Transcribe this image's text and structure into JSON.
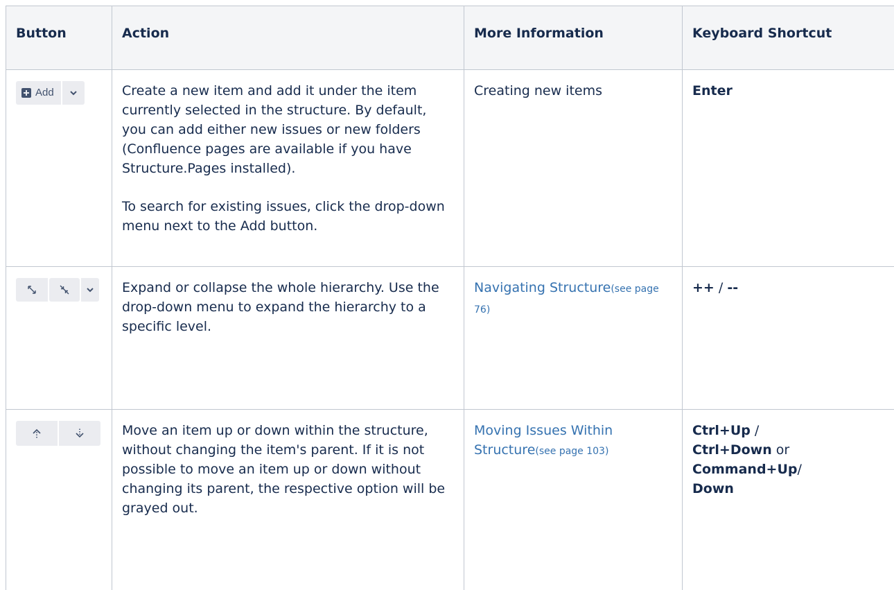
{
  "headers": {
    "button": "Button",
    "action": "Action",
    "more_info": "More Information",
    "shortcut": "Keyboard Shortcut"
  },
  "rows": [
    {
      "button": {
        "add_label": "Add",
        "icons": [
          "plus-square-icon",
          "chevron-down-icon"
        ]
      },
      "action": [
        "Create a new item and add it under the item currently selected in the structure. By default, you can add either new issues or new folders (Confluence pages are available if you have Structure.Pages installed).",
        "To search for existing issues, click the drop-down menu next to the Add button."
      ],
      "more_info": {
        "text": "Creating new items",
        "link": false
      },
      "shortcut": {
        "parts": [
          {
            "text": "Enter",
            "bold": true
          }
        ]
      }
    },
    {
      "button": {
        "icons": [
          "expand-icon",
          "collapse-icon",
          "chevron-down-icon"
        ]
      },
      "action": [
        "Expand or collapse the whole hierarchy. Use the drop-down menu to expand the hierarchy to a specific level."
      ],
      "more_info": {
        "text": "Navigating Structure",
        "page_ref": "(see page 76)",
        "link": true
      },
      "shortcut": {
        "parts": [
          {
            "text": "++",
            "bold": true
          },
          {
            "text": " / ",
            "bold": false
          },
          {
            "text": "--",
            "bold": true
          }
        ]
      }
    },
    {
      "button": {
        "icons": [
          "move-up-icon",
          "move-down-icon"
        ]
      },
      "action": [
        "Move an item up or down within the structure, without changing the item's parent. If it is not possible to move an item up or down without changing its parent, the respective option will be grayed out."
      ],
      "more_info": {
        "text": "Moving Issues Within Structure",
        "page_ref": "(see page 103)",
        "link": true
      },
      "shortcut": {
        "parts": [
          {
            "text": "Ctrl+Up",
            "bold": true
          },
          {
            "text": " / ",
            "bold": false
          },
          {
            "text": "Ctrl+Down",
            "bold": true
          },
          {
            "text": " or ",
            "bold": false
          },
          {
            "text": "Command+Up",
            "bold": true
          },
          {
            "text": "/ ",
            "bold": false
          },
          {
            "text": "Down",
            "bold": true
          }
        ]
      }
    }
  ],
  "colors": {
    "header_bg": "#f4f5f7",
    "border": "#c1c7d0",
    "link": "#3572b0",
    "button_bg": "#ebecf0",
    "icon": "#42526e"
  }
}
